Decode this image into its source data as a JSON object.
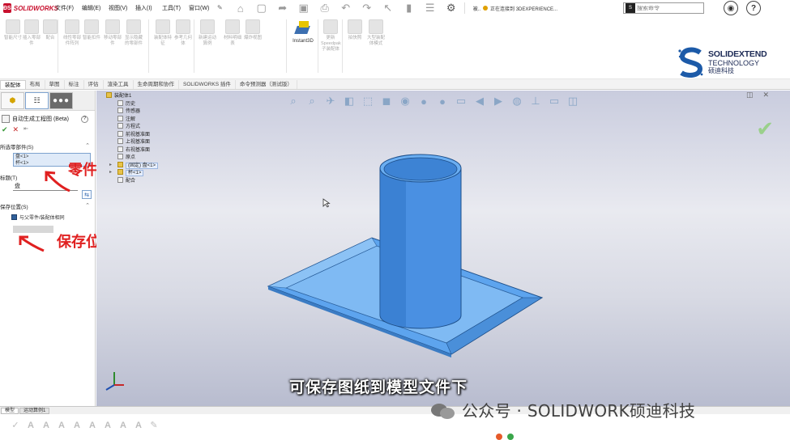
{
  "app": {
    "brand": "SOLIDWORKS"
  },
  "menu": [
    "文件(F)",
    "编辑(E)",
    "视图(V)",
    "插入(I)",
    "工具(T)",
    "窗口(W)"
  ],
  "connection_status": "正在连接到 3DEXPERIENCE...",
  "connection_prefix": "被..",
  "search": {
    "placeholder": "搜索命令"
  },
  "ribbon_buttons": [
    "智能尺寸",
    "插入零部件",
    "配合",
    "线性零部件阵列",
    "智能扣件",
    "移动零部件",
    "显示隐藏的零部件",
    "装配体特征",
    "参考几何体",
    "新建运动算例",
    "材料明细表",
    "爆炸视图",
    "Instant3D",
    "更新Speedpak子装配体",
    "拍快照",
    "大型装配体模式"
  ],
  "instant3d_label": "Instant3D",
  "brand_logo": {
    "line1": "SOLIDEXTEND",
    "line2": "TECHNOLOGY",
    "line3": "硕迪科技"
  },
  "tabs": [
    {
      "label": "装配体",
      "active": true
    },
    {
      "label": "布局",
      "active": false
    },
    {
      "label": "草图",
      "active": false
    },
    {
      "label": "标注",
      "active": false
    },
    {
      "label": "评估",
      "active": false
    },
    {
      "label": "渲染工具",
      "active": false
    },
    {
      "label": "生命周期和协作",
      "active": false
    },
    {
      "label": "SOLIDWORKS 插件",
      "active": false
    },
    {
      "label": "命令预测器（测试版）",
      "active": false
    }
  ],
  "property_manager": {
    "title": "自动生成工程图 (Beta)",
    "help": "?",
    "group_selected": "所选零部件(S)",
    "selected_items": [
      "盘<1>",
      "杯<1>"
    ],
    "group_title": "标题(T)",
    "title_value": "盘",
    "group_save": "保存位置(S)",
    "checkbox_label": "与父零件/装配体相同",
    "tab_more": "●●●"
  },
  "annotations": {
    "part_name": "零件名称",
    "save_location": "保存位置"
  },
  "feature_tree": [
    {
      "label": "装配体1",
      "indent": 0,
      "icon": "assembly"
    },
    {
      "label": "历史",
      "indent": 1,
      "icon": "history"
    },
    {
      "label": "传感器",
      "indent": 1,
      "icon": "sensor"
    },
    {
      "label": "注解",
      "indent": 1,
      "icon": "annotation"
    },
    {
      "label": "方程式",
      "indent": 1,
      "icon": "equation"
    },
    {
      "label": "前视基准面",
      "indent": 1,
      "icon": "plane"
    },
    {
      "label": "上视基准面",
      "indent": 1,
      "icon": "plane"
    },
    {
      "label": "右视基准面",
      "indent": 1,
      "icon": "plane"
    },
    {
      "label": "原点",
      "indent": 1,
      "icon": "origin"
    },
    {
      "label": "(固定) 盘<1>",
      "indent": 1,
      "icon": "part-gold"
    },
    {
      "label": "杯<1>",
      "indent": 1,
      "icon": "part-gold"
    },
    {
      "label": "配合",
      "indent": 1,
      "icon": "mates"
    }
  ],
  "subtitle": "可保存图纸到模型文件下",
  "bottom_tabs": [
    "模型",
    "运动算例1"
  ],
  "watermark": "公众号 · SOLIDWORK硕迪科技",
  "colors": {
    "accent_red": "#e02020",
    "model_blue": "#4a90d9",
    "brand_navy": "#1c2a55"
  }
}
